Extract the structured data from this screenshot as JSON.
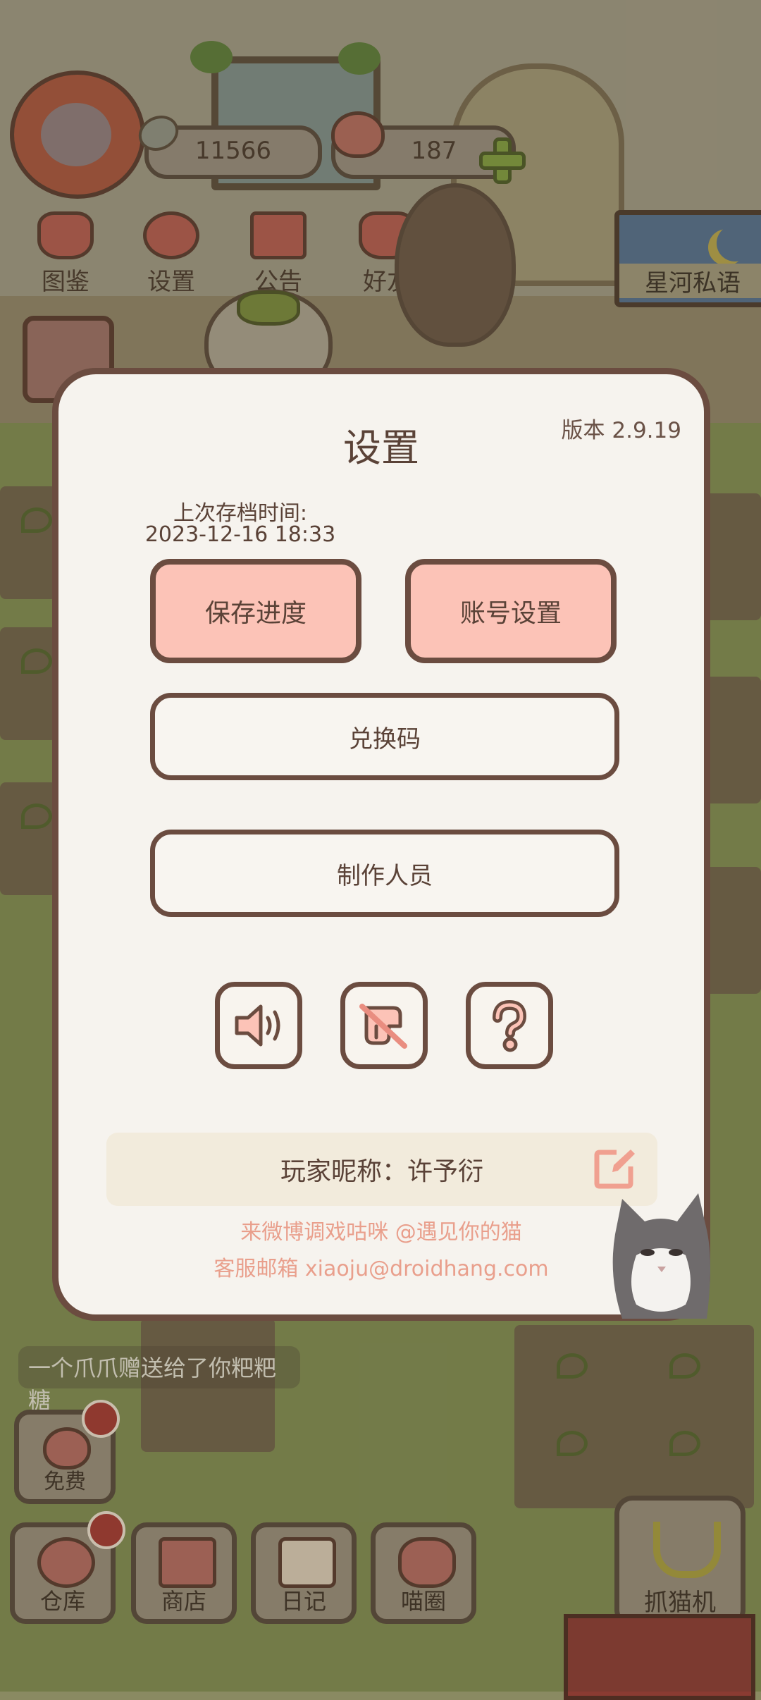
{
  "hud": {
    "coins": "11566",
    "hearts": "187"
  },
  "top_nav": [
    {
      "label": "图鉴",
      "icon": "cat-book-icon"
    },
    {
      "label": "设置",
      "icon": "gear-icon"
    },
    {
      "label": "公告",
      "icon": "gift-icon"
    },
    {
      "label": "好友",
      "icon": "friends-icon"
    }
  ],
  "xinghe_label": "星河私语",
  "settings": {
    "title": "设置",
    "version": "版本 2.9.19",
    "last_save_label": "上次存档时间:",
    "last_save_time": "2023-12-16 18:33",
    "save_progress": "保存进度",
    "account_settings": "账号设置",
    "redeem_code": "兑换码",
    "credits": "制作人员",
    "icon_buttons": [
      "sound-on-icon",
      "music-off-icon",
      "help-icon"
    ],
    "nickname": "玩家昵称：许予衍",
    "weibo_line": "来微博调戏咕咪 @遇见你的猫",
    "email_line": "客服邮箱 xiaoju@droidhang.com"
  },
  "chat_message": "一个爪爪赠送给了你粑粑糖",
  "free_label": "免费",
  "dock": [
    {
      "label": "仓库",
      "icon": "warehouse-icon"
    },
    {
      "label": "商店",
      "icon": "shop-icon"
    },
    {
      "label": "日记",
      "icon": "diary-icon"
    },
    {
      "label": "喵圈",
      "icon": "cat-planet-icon"
    }
  ],
  "claw_machine_label": "抓猫机",
  "colors": {
    "modal_bg": "#f6f3ee",
    "modal_border": "#6b4c40",
    "pink_button": "#fcc3b7",
    "footer_text": "#e99f8c"
  }
}
